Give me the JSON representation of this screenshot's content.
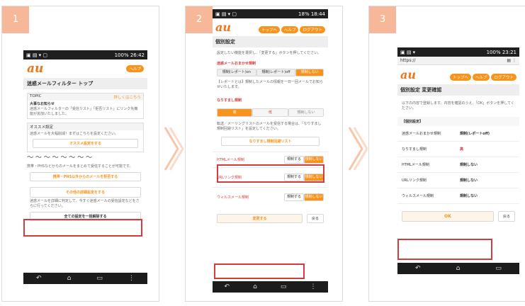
{
  "steps": [
    "1",
    "2",
    "3"
  ],
  "s1": {
    "status": "100% 26:42",
    "help": "ヘルプ",
    "title": "迷惑メールフィルター トップ",
    "topic": "TOPIC",
    "topic_more": "詳しくはこちら",
    "news_title": "大事なお知らせ",
    "news_body": "迷惑メールフィルターの「受信リスト」「拒否リスト」にリンク先機能が追加いたしました。",
    "rec_title": "オススメ設定",
    "rec_body": "迷惑メールを大幅削減！まずはこちらを設定ください。",
    "rec_btn": "オススメ設定をする",
    "pc_body": "携帯・PHSなどからのメールをまとめて受信することが可能です。",
    "pc_btn": "携帯・PHS以外からのメールを拒否する",
    "detail_btn": "その他の詳細設定をする",
    "detail_note": "迷惑メールを詳細に判定して、今すぐ迷惑メールの受信設定などをさらに行ってください。",
    "all_btn": "全ての設定を一括解除する"
  },
  "s2": {
    "status": "18% 18:44",
    "menu": [
      "トップへ",
      "ヘルプ",
      "ログアウト"
    ],
    "title": "個別設定",
    "intro": "設定したい機能を選択し、「変更する」ボタンを押してください。",
    "sec1": "迷惑メールおまかせ規制",
    "sec1_opts": [
      "規制(レポート)on",
      "規制(レポート)off",
      "規制しない"
    ],
    "report_note": "【レポートとは】規制したメールの情報を一日一回メールでお知らせいたします。",
    "sec2": "なりすまし規制",
    "sec2_opts": [
      "高",
      "低",
      "規制しない"
    ],
    "relay_note": "転送／メーリングリストのメールを受信する場合は、「なりすまし規制回避リスト」を設定してください。",
    "relay_btn": "なりすまし規制回避リスト",
    "rows": [
      {
        "label": "HTMLメール規制",
        "on": "規制する",
        "off": "規制しない"
      },
      {
        "label": "URLリンク規制",
        "on": "規制する",
        "off": "規制しない"
      },
      {
        "label": "ウィルスメール規制",
        "on": "規制する",
        "off": "規制しない"
      }
    ],
    "change_btn": "変更する",
    "back_btn": "戻る"
  },
  "s3": {
    "status": "100% 23:21",
    "url": "https://",
    "menu": [
      "トップへ",
      "ヘルプ",
      "ログアウト"
    ],
    "title": "個別設定 変更確認",
    "intro": "以下の内容で登録します。内容を確認のうえ、「OK」ボタンを押してください。",
    "sec": "【個別設定】",
    "rows": [
      {
        "label": "迷惑メールおまかせ規制",
        "value": "規制(レポートoff)"
      },
      {
        "label": "なりすまし規制",
        "value": "高"
      },
      {
        "label": "HTMLメール規制",
        "value": "規制しない"
      },
      {
        "label": "URLリンク規制",
        "value": "規制しない"
      },
      {
        "label": "ウィルスメール規制",
        "value": "規制しない"
      }
    ],
    "ok_btn": "OK",
    "back_btn": "戻る"
  },
  "brand": "au",
  "colors": {
    "accent": "#f7941d",
    "highlight": "#d23c3c",
    "badge": "#f7b89a"
  }
}
